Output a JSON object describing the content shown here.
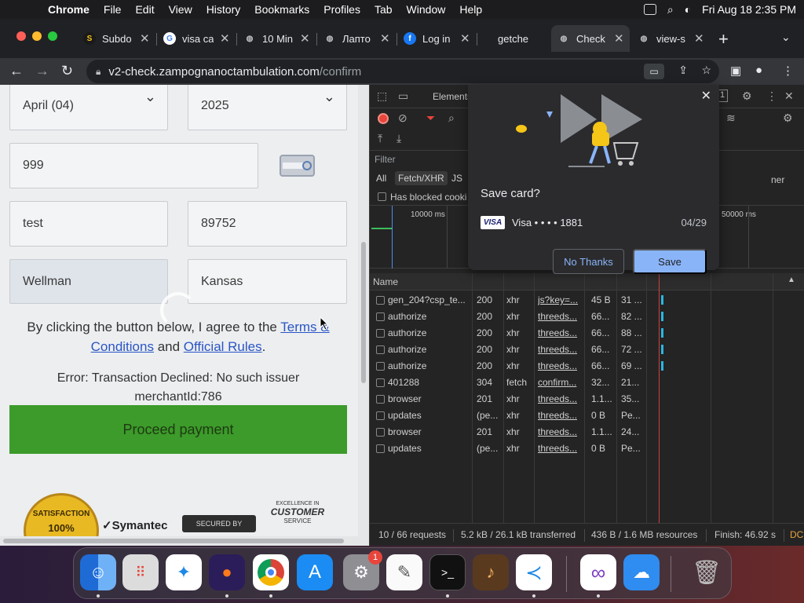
{
  "menubar": {
    "app": "Chrome",
    "items": [
      "File",
      "Edit",
      "View",
      "History",
      "Bookmarks",
      "Profiles",
      "Tab",
      "Window",
      "Help"
    ],
    "datetime": "Fri Aug 18  2:35 PM"
  },
  "tabs": [
    {
      "title": "Subdo",
      "fav": "S",
      "color": "#1a1a1a"
    },
    {
      "title": "visa ca",
      "fav": "G",
      "color": "#ffffff"
    },
    {
      "title": "10 Min",
      "fav": "◍",
      "color": "#5f6368"
    },
    {
      "title": "Лапто",
      "fav": "◍",
      "color": "#5f6368"
    },
    {
      "title": "Log in",
      "fav": "f",
      "color": "#1877f2"
    },
    {
      "title": "getche",
      "fav": "",
      "color": "#202124"
    },
    {
      "title": "Check",
      "fav": "◍",
      "color": "#5f6368"
    },
    {
      "title": "view-s",
      "fav": "◍",
      "color": "#5f6368"
    }
  ],
  "address": {
    "host": "v2-check.zampognanoctambulation.com",
    "path": "/confirm"
  },
  "form": {
    "month": "April (04)",
    "year": "2025",
    "cvv": "999",
    "first": "test",
    "zip": "89752",
    "city": "Wellman",
    "state": "Kansas",
    "agree_text": "By clicking the button below, I agree to the ",
    "terms_link": "Terms & Conditions",
    "and": " and ",
    "rules_link": "Official Rules",
    "period": ".",
    "error_line1": "Error: Transaction Declined: No such issuer",
    "error_line2": "merchantId:786",
    "proceed": "Proceed payment"
  },
  "badges": {
    "satisfaction": "SATISFACTION",
    "pct": "100%",
    "symantec": "Symantec",
    "secured": "SECURED BY",
    "excellence": "EXCELLENCE IN",
    "customer": "CUSTOMER",
    "service": "SERVICE"
  },
  "devtools": {
    "elements_tab": "Elements",
    "badge_count": "1",
    "filter_placeholder": "Filter",
    "filters": [
      "All",
      "Fetch/XHR",
      "JS"
    ],
    "blocked": "Has blocked cooki",
    "other_label": "ner",
    "timeline": [
      "10000 ms",
      "50000 ms"
    ],
    "col_name": "Name",
    "rows": [
      {
        "name": "gen_204?csp_te...",
        "status": "200",
        "type": "xhr",
        "init": "js?key=...",
        "size": "45 B",
        "time": "31 ..."
      },
      {
        "name": "authorize",
        "status": "200",
        "type": "xhr",
        "init": "threeds...",
        "size": "66...",
        "time": "82 ..."
      },
      {
        "name": "authorize",
        "status": "200",
        "type": "xhr",
        "init": "threeds...",
        "size": "66...",
        "time": "88 ..."
      },
      {
        "name": "authorize",
        "status": "200",
        "type": "xhr",
        "init": "threeds...",
        "size": "66...",
        "time": "72 ..."
      },
      {
        "name": "authorize",
        "status": "200",
        "type": "xhr",
        "init": "threeds...",
        "size": "66...",
        "time": "69 ..."
      },
      {
        "name": "401288",
        "status": "304",
        "type": "fetch",
        "init": "confirm...",
        "size": "32...",
        "time": "21..."
      },
      {
        "name": "browser",
        "status": "201",
        "type": "xhr",
        "init": "threeds...",
        "size": "1.1...",
        "time": "35..."
      },
      {
        "name": "updates",
        "status": "(pe...",
        "type": "xhr",
        "init": "threeds...",
        "size": "0 B",
        "time": "Pe..."
      },
      {
        "name": "browser",
        "status": "201",
        "type": "xhr",
        "init": "threeds...",
        "size": "1.1...",
        "time": "24..."
      },
      {
        "name": "updates",
        "status": "(pe...",
        "type": "xhr",
        "init": "threeds...",
        "size": "0 B",
        "time": "Pe..."
      }
    ],
    "status_requests": "10 / 66 requests",
    "status_transferred": "5.2 kB / 26.1 kB transferred",
    "status_resources": "436 B / 1.6 MB resources",
    "status_finish": "Finish: 46.92 s",
    "status_dc": "DC"
  },
  "savecard": {
    "title": "Save card?",
    "brand": "VISA",
    "card_label": "Visa  • • • • 1881",
    "expiry": "04/29",
    "no_thanks": "No Thanks",
    "save": "Save"
  },
  "dock": {
    "settings_badge": "1",
    "terminal_prompt": ">_"
  }
}
